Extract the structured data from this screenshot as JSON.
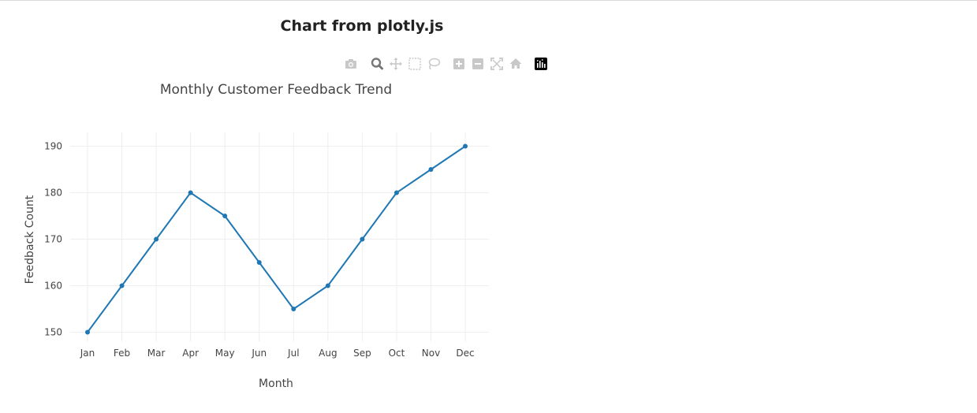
{
  "page": {
    "heading": "Chart from plotly.js"
  },
  "modebar": {
    "buttons": [
      {
        "icon": "camera-icon"
      },
      {
        "icon": "zoom-icon"
      },
      {
        "icon": "pan-icon"
      },
      {
        "icon": "box-select-icon"
      },
      {
        "icon": "lasso-select-icon"
      },
      {
        "icon": "zoom-in-icon"
      },
      {
        "icon": "zoom-out-icon"
      },
      {
        "icon": "autoscale-icon"
      },
      {
        "icon": "reset-axes-icon"
      },
      {
        "icon": "plotly-logo-icon"
      }
    ]
  },
  "colors": {
    "line": "#1f77b4",
    "grid": "#eeeeee",
    "text": "#444444",
    "modebar_icon": "#c8c8c8",
    "modebar_active": "#777777"
  },
  "chart_data": {
    "type": "line",
    "title": "Monthly Customer Feedback Trend",
    "xlabel": "Month",
    "ylabel": "Feedback Count",
    "categories": [
      "Jan",
      "Feb",
      "Mar",
      "Apr",
      "May",
      "Jun",
      "Jul",
      "Aug",
      "Sep",
      "Oct",
      "Nov",
      "Dec"
    ],
    "values": [
      150,
      160,
      170,
      180,
      175,
      165,
      155,
      160,
      170,
      180,
      185,
      190
    ],
    "y_ticks": [
      150,
      160,
      170,
      180,
      190
    ],
    "ylim": [
      147,
      193
    ],
    "grid": true,
    "markers": true
  }
}
